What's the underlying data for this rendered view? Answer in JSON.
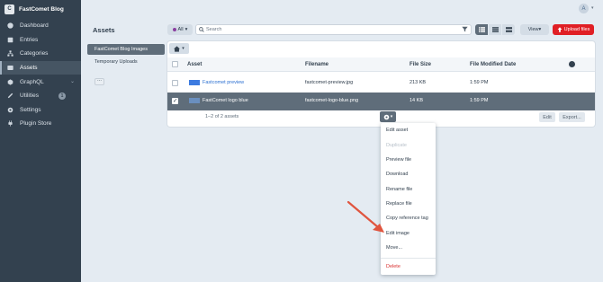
{
  "site": {
    "logo_letter": "C",
    "name": "FastComet Blog"
  },
  "nav": [
    {
      "label": "Dashboard",
      "icon": "gauge-icon"
    },
    {
      "label": "Entries",
      "icon": "entries-icon"
    },
    {
      "label": "Categories",
      "icon": "sitemap-icon"
    },
    {
      "label": "Assets",
      "icon": "image-icon",
      "active": true
    },
    {
      "label": "GraphQL",
      "icon": "graphql-icon"
    },
    {
      "label": "Utilities",
      "icon": "wrench-icon",
      "badge": "1"
    },
    {
      "label": "Settings",
      "icon": "gear-icon"
    },
    {
      "label": "Plugin Store",
      "icon": "plug-icon"
    }
  ],
  "user": {
    "avatar_letter": "A"
  },
  "page": {
    "title": "Assets"
  },
  "sources": [
    "FastComet Blog Images",
    "Temporary Uploads"
  ],
  "toolbar": {
    "site_filter": "All",
    "search_placeholder": "Search",
    "view_label": "View",
    "upload_label": "Upload files"
  },
  "table": {
    "columns": [
      "Asset",
      "Filename",
      "File Size",
      "File Modified Date"
    ],
    "rows": [
      {
        "title": "Fastcomet preview",
        "filename": "fastcomet-preview.jpg",
        "size": "213 KB",
        "date": "1:59 PM",
        "selected": false
      },
      {
        "title": "FastComet logo blue",
        "filename": "fastcomet-logo-blue.png",
        "size": "14 KB",
        "date": "1:59 PM",
        "selected": true
      }
    ],
    "count_text": "1–2 of 2 assets",
    "edit_label": "Edit",
    "export_label": "Export..."
  },
  "menu": {
    "items": [
      "Edit asset",
      "Duplicate",
      "Preview file",
      "Download",
      "Rename file",
      "Replace file",
      "Copy reference tag",
      "Edit image",
      "Move..."
    ],
    "delete": "Delete"
  },
  "colors": {
    "accent": "#e01f25",
    "sidebar": "#33414f",
    "selected_row": "#5f6d7a"
  }
}
